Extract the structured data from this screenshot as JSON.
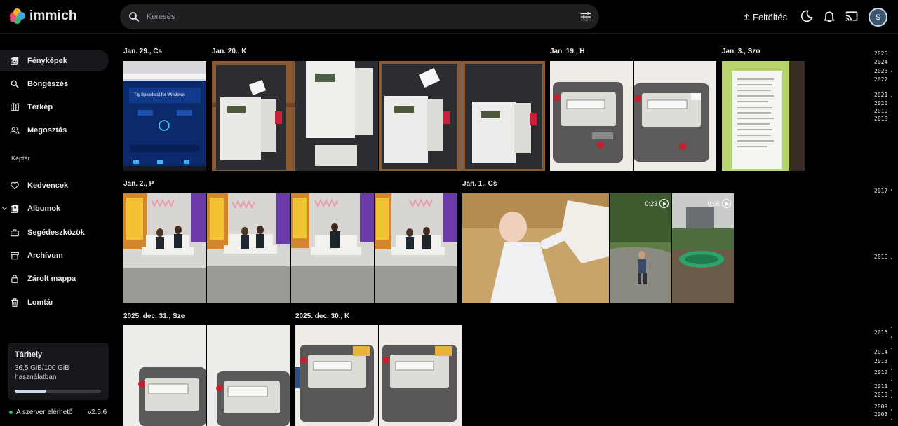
{
  "app": {
    "name": "immich"
  },
  "header": {
    "search_placeholder": "Keresés",
    "upload_label": "Feltöltés",
    "avatar_initial": "S"
  },
  "sidebar": {
    "items": [
      {
        "label": "Fényképek",
        "icon": "photos-icon",
        "active": true
      },
      {
        "label": "Böngészés",
        "icon": "search-icon"
      },
      {
        "label": "Térkép",
        "icon": "map-icon"
      },
      {
        "label": "Megosztás",
        "icon": "people-icon"
      }
    ],
    "section_label": "Képtár",
    "library_items": [
      {
        "label": "Kedvencek",
        "icon": "heart-icon"
      },
      {
        "label": "Albumok",
        "icon": "album-icon"
      },
      {
        "label": "Segédeszközök",
        "icon": "toolbox-icon"
      },
      {
        "label": "Archívum",
        "icon": "archive-icon"
      },
      {
        "label": "Zárolt mappa",
        "icon": "lock-icon"
      },
      {
        "label": "Lomtár",
        "icon": "trash-icon"
      }
    ]
  },
  "storage": {
    "title": "Tárhely",
    "usage_text": "36,5 GiB/100 GiB használatban",
    "used_fraction": 0.365
  },
  "status": {
    "server_text": "A szerver elérhető",
    "version": "v2.5.6"
  },
  "timeline": {
    "groups": [
      {
        "label": "Jan. 29., Cs",
        "photos": [
          "monitor-screen"
        ]
      },
      {
        "label": "Jan. 20., K",
        "photos": [
          "electric-meter",
          "electric-meter",
          "electric-meter",
          "electric-meter"
        ]
      },
      {
        "label": "Jan. 19., H",
        "photos": [
          "gas-meter",
          "gas-meter"
        ]
      },
      {
        "label": "Jan. 3., Szo",
        "photos": [
          "paper-list"
        ]
      },
      {
        "label": "Jan. 2., P",
        "photos": [
          "kids-on-sofa",
          "kids-on-sofa",
          "kids-on-sofa",
          "kids-on-sofa"
        ]
      },
      {
        "label": "Jan. 1., Cs",
        "photos": [
          "baby",
          "child-in-yard",
          "swing"
        ],
        "videos": [
          "0:23",
          "0:05"
        ]
      },
      {
        "label": "2025. dec. 31., Sze",
        "photos": [
          "gas-meter",
          "gas-meter"
        ]
      },
      {
        "label": "2025. dec. 30., K",
        "photos": [
          "gas-meter",
          "gas-meter"
        ]
      }
    ]
  },
  "scrubber": {
    "years": [
      "2025",
      "2024",
      "2023",
      "2022",
      "2021",
      "2020",
      "2019",
      "2018",
      "2017",
      "2016",
      "2015",
      "2014",
      "2013",
      "2012",
      "2011",
      "2010",
      "2009",
      "2003"
    ]
  }
}
